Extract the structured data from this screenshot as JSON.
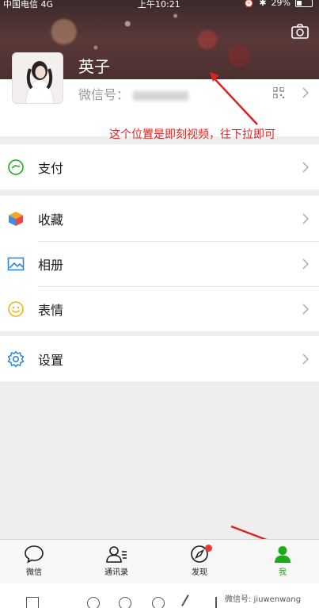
{
  "status_bar": {
    "carrier": "中国电信 4G",
    "time": "上午10:21",
    "battery": "29%"
  },
  "profile": {
    "name": "英子",
    "wechat_id_label": "微信号："
  },
  "annotation": "这个位置是即刻视频，往下拉即可",
  "menu": {
    "pay": "支付",
    "favorites": "收藏",
    "album": "相册",
    "stickers": "表情",
    "settings": "设置"
  },
  "tabbar": {
    "chats": "微信",
    "contacts": "通讯录",
    "discover": "发现",
    "me": "我"
  },
  "watermark": "微信号: jiuwenwang",
  "colors": {
    "accent": "#1aad19",
    "annotation": "#dd2222",
    "badge": "#f43530"
  }
}
